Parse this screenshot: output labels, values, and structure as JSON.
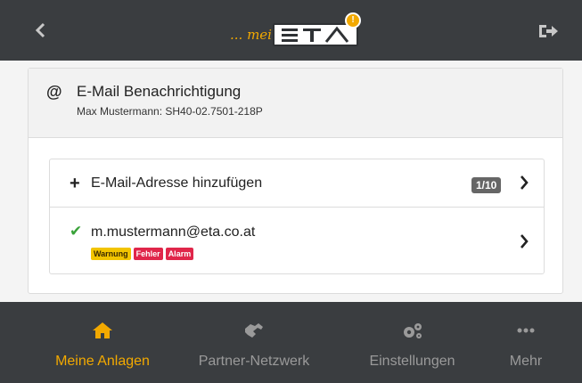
{
  "colors": {
    "bar": "#3a3d40",
    "accent": "#f2a900",
    "inactive": "#9a9a9a",
    "check": "#3aa23a",
    "warn": "#f2c400",
    "error": "#e0264a",
    "badge": "#666666"
  },
  "topbar": {
    "back_icon": "chevron-left-icon",
    "logo_prefix": "... mein",
    "logo_text": "ETA",
    "logout_icon": "logout-icon"
  },
  "card": {
    "header": {
      "icon": "@",
      "title": "E-Mail Benachrichtigung",
      "subtitle": "Max Mustermann: SH40-02.7501-218P"
    },
    "add_row": {
      "icon": "+",
      "label": "E-Mail-Adresse hinzufügen",
      "count": "1/10"
    },
    "email_row": {
      "icon": "✔",
      "email": "m.mustermann@eta.co.at",
      "tags": [
        {
          "label": "Warnung",
          "bg": "#f2c400",
          "fg": "#3a2a00"
        },
        {
          "label": "Fehler",
          "bg": "#e0264a",
          "fg": "#ffffff"
        },
        {
          "label": "Alarm",
          "bg": "#e0264a",
          "fg": "#ffffff"
        }
      ]
    }
  },
  "bottom_nav": {
    "items": [
      {
        "label": "Meine Anlagen",
        "icon": "home-icon",
        "active": true
      },
      {
        "label": "Partner-Netzwerk",
        "icon": "handshake-icon",
        "active": false
      },
      {
        "label": "Einstellungen",
        "icon": "cogs-icon",
        "active": false
      },
      {
        "label": "Mehr",
        "icon": "more-icon",
        "active": false
      }
    ]
  }
}
